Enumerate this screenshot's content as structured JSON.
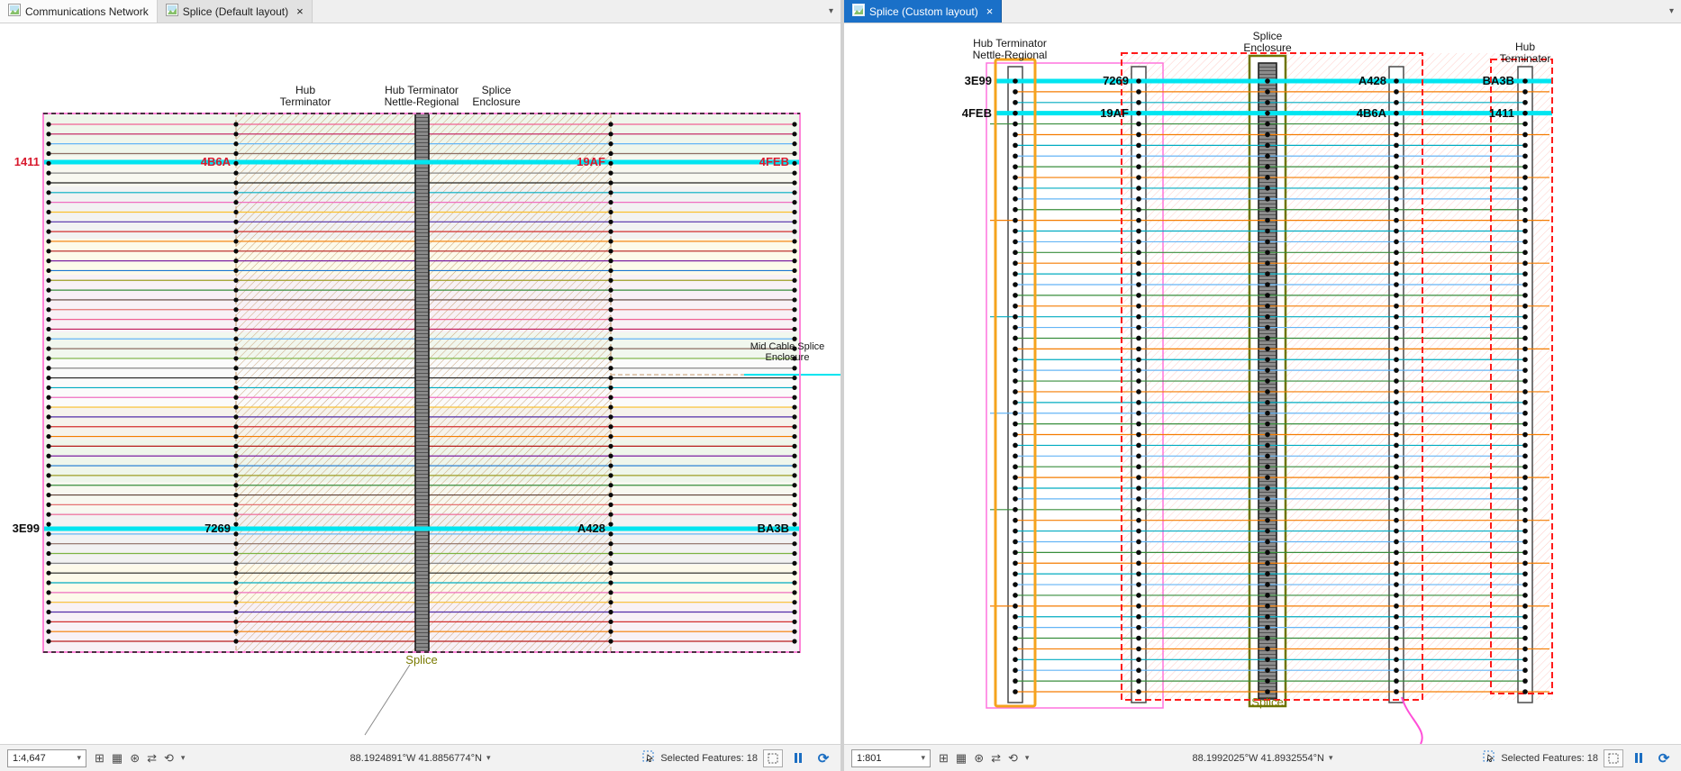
{
  "icons": {
    "chevron_down": "▾",
    "overflow": "▾",
    "close": "×",
    "grid": "⊞",
    "table": "▦",
    "snap": "⊛",
    "swap": "⇄",
    "rotate": "⟲",
    "refresh": "⟳"
  },
  "colors": {
    "accent_blue": "#1a70c8",
    "highlight_cyan": "#00e5f0",
    "selection_pink": "#ff73de",
    "outer_pink": "#ff84d8",
    "enclosure_red": "#ff1a1a",
    "enclosure_orange": "#f5a31d",
    "enclosure_olive": "#6d7400",
    "hatch_tan": "#c49a6c",
    "hatch_red": "#ff9d94",
    "splice_label_olive": "#7a7a00",
    "id_red": "#d8192d",
    "id_black": "#0d0d0d"
  },
  "fiber_palette": [
    "#d32f2f",
    "#7b1fa2",
    "#388e3c",
    "#f06292",
    "#8d6e63",
    "#212121",
    "#fbc02d",
    "#f57c00",
    "#1976d2",
    "#5d4037",
    "#c2185b",
    "#7cb342",
    "#00acc1",
    "#512da8",
    "#b71c1c",
    "#9e9d24",
    "#e57373",
    "#64b5f6",
    "#888888",
    "#ef6fc0"
  ],
  "band_palette": [
    "#e2efda",
    "#f2f2e4",
    "#e8e8e8",
    "#fbf6d9",
    "#f3e6ef",
    "#e6f0e0",
    "#f7f7f7",
    "#efe9dc"
  ],
  "left_pane": {
    "tabs": [
      {
        "label": "Communications Network"
      },
      {
        "label": "Splice (Default layout)"
      }
    ],
    "diagram": {
      "labels": {
        "hub_terminator_line1": "Hub",
        "hub_terminator_line2": "Terminator",
        "nettle_line1": "Hub Terminator",
        "nettle_line2": "Nettle-Regional",
        "splice_enclosure_line1": "Splice",
        "splice_enclosure_line2": "Enclosure",
        "mid_cable_line1": "Mid Cable Splice",
        "mid_cable_line2": "Enclosure",
        "splice": "Splice"
      },
      "highlight_top": {
        "items": [
          "1411",
          "4B6A",
          "19AF",
          "4FEB"
        ]
      },
      "highlight_bottom": {
        "items": [
          "3E99",
          "7269",
          "A428",
          "BA3B"
        ]
      }
    },
    "statusbar": {
      "scale": "1:4,647",
      "coordinates": "88.1924891°W 41.8856774°N",
      "selected_features_label": "Selected Features:",
      "selected_features_count": "18"
    }
  },
  "right_pane": {
    "tabs": [
      {
        "label": "Splice (Custom layout)"
      }
    ],
    "diagram": {
      "labels": {
        "nettle_line1": "Hub Terminator",
        "nettle_line2": "Nettle-Regional",
        "splice_enclosure_line1": "Splice",
        "splice_enclosure_line2": "Enclosure",
        "hub_terminator_line1": "Hub",
        "hub_terminator_line2": "Terminator",
        "splice": "Splice"
      },
      "row1": {
        "items": [
          "3E99",
          "7269",
          "A428",
          "BA3B"
        ]
      },
      "row2": {
        "items": [
          "4FEB",
          "19AF",
          "4B6A",
          "1411"
        ]
      }
    },
    "statusbar": {
      "scale": "1:801",
      "coordinates": "88.1992025°W 41.8932554°N",
      "selected_features_label": "Selected Features:",
      "selected_features_count": "18"
    }
  }
}
